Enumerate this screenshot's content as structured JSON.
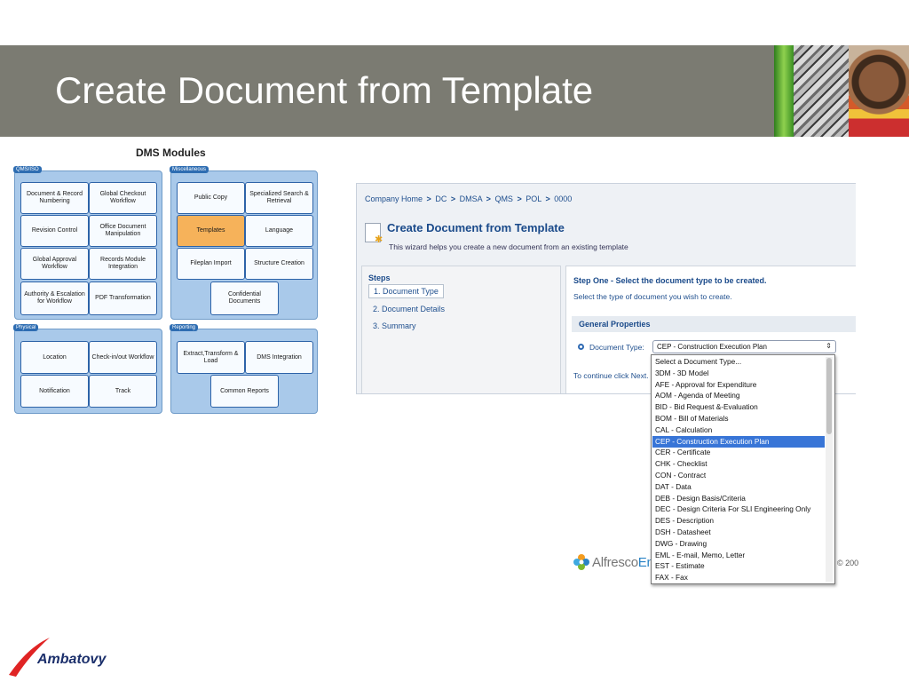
{
  "slide": {
    "title": "Create Document from Template"
  },
  "dms": {
    "title": "DMS Modules",
    "groups": [
      {
        "label": "QMS/ISO",
        "modules": [
          "Document & Record Numbering",
          "Global Checkout Workflow",
          "Revision Control",
          "Office Document Manipulation",
          "Global Approval Workflow",
          "Records Module Integration",
          "Authority & Escalation for Workflow",
          "PDF Transformation"
        ]
      },
      {
        "label": "Miscellaneous",
        "modules": [
          "Public Copy",
          "Specialized Search & Retrieval",
          "Templates",
          "Language",
          "Fileplan Import",
          "Structure Creation",
          "Confidential Documents"
        ]
      },
      {
        "label": "Physical",
        "modules": [
          "Location",
          "Check-in/out Workflow",
          "Notification",
          "Track"
        ]
      },
      {
        "label": "Reporting",
        "modules": [
          "Extract,Transform & Load",
          "DMS Integration",
          "Common Reports"
        ]
      }
    ],
    "highlight_color": "#f6b25a"
  },
  "app": {
    "breadcrumb": [
      "Company Home",
      "DC",
      "DMSA",
      "QMS",
      "POL",
      "0000"
    ],
    "breadcrumb_sep": ">",
    "wizard_title": "Create Document from Template",
    "wizard_desc": "This wizard helps you create a new document from an existing template",
    "steps_label": "Steps",
    "steps": [
      "1. Document Type",
      "2. Document Details",
      "3. Summary"
    ],
    "step_one_title": "Step One - Select the document type to be created.",
    "step_one_desc": "Select the type of document you wish to create.",
    "general_properties": "General Properties",
    "doc_type_label": "Document Type:",
    "doc_type_value": "CEP - Construction Execution Plan",
    "select_arrows": "⇕",
    "continue_text": "To continue click Next.",
    "dropdown_options": [
      "Select a Document Type...",
      "3DM - 3D Model",
      "AFE - Approval for Expenditure",
      "AOM - Agenda of Meeting",
      "BID - Bid Request &-Evaluation",
      "BOM - Bill of Materials",
      "CAL - Calculation",
      "CEP - Construction Execution Plan",
      "CER - Certificate",
      "CHK - Checklist",
      "CON - Contract",
      "DAT - Data",
      "DEB - Design Basis/Criteria",
      "DEC - Design Criteria For SLI Engineering Only",
      "DES - Description",
      "DSH - Datasheet",
      "DWG - Drawing",
      "EML - E-mail, Memo, Letter",
      "EST - Estimate",
      "FAX - Fax"
    ],
    "selected_index": 7,
    "selected_color": "#3875d7",
    "footer_brand": "Alfresco",
    "footer_brand_suffix": "Ent",
    "footer_copyright": "© 200"
  },
  "brand": {
    "name": "Ambatovy",
    "color": "#1b2f6b",
    "accent": "#e02424"
  }
}
